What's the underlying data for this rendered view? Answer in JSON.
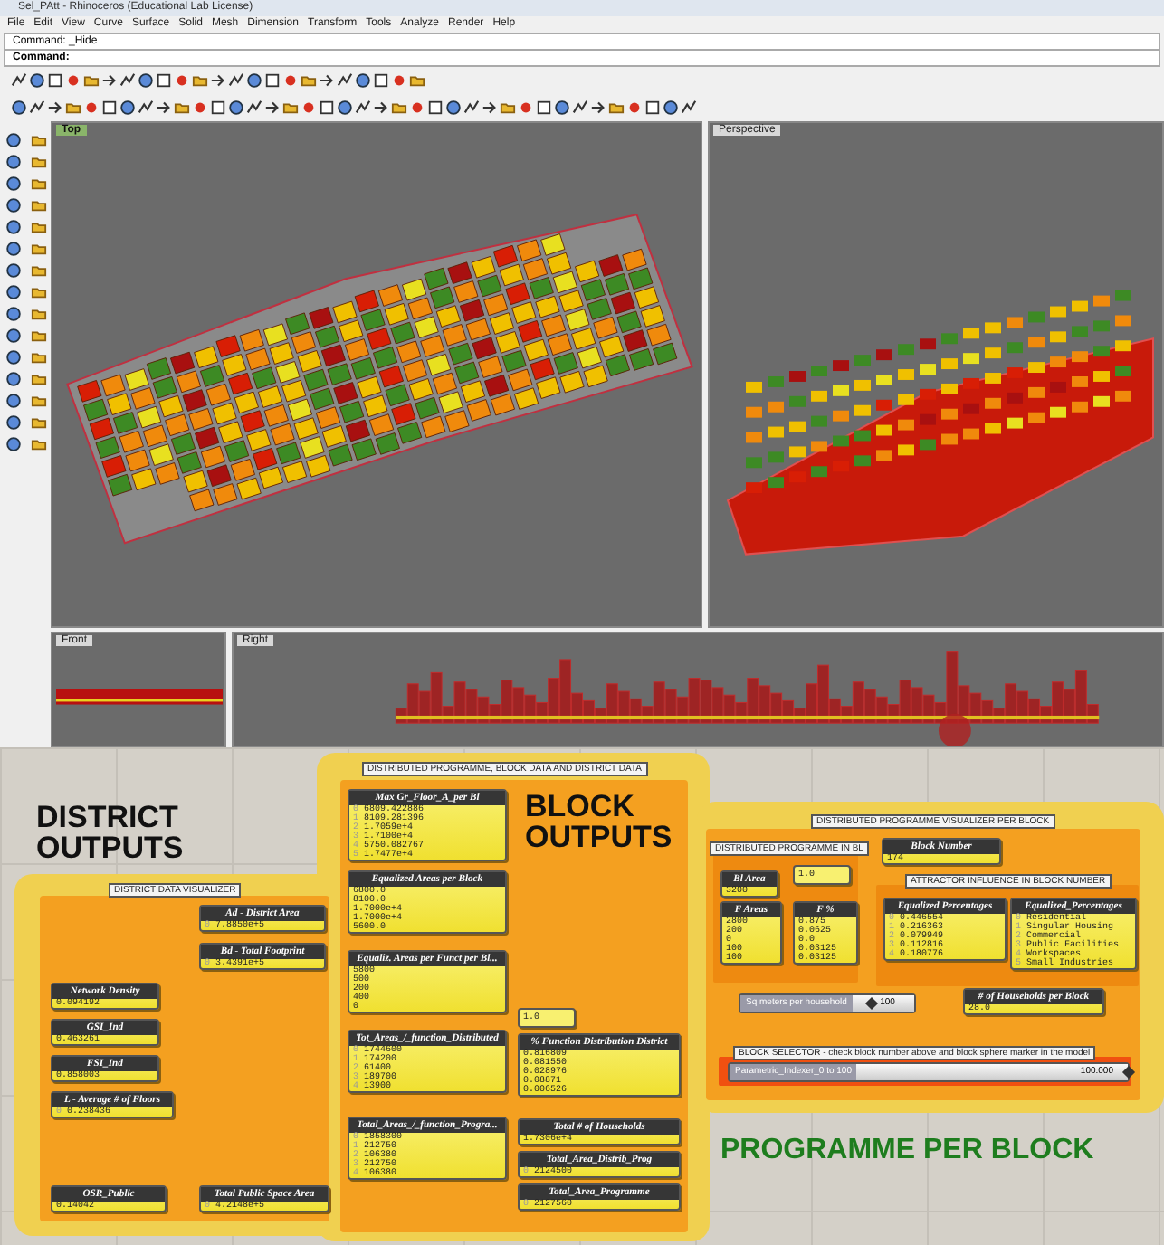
{
  "window": {
    "title": "Sel_PAtt - Rhinoceros (Educational Lab License)"
  },
  "menu": [
    "File",
    "Edit",
    "View",
    "Curve",
    "Surface",
    "Solid",
    "Mesh",
    "Dimension",
    "Transform",
    "Tools",
    "Analyze",
    "Render",
    "Help"
  ],
  "command_history": "Command: _Hide",
  "command_prompt": "Command:",
  "viewports": [
    {
      "label": "Top",
      "selected": true
    },
    {
      "label": "Perspective",
      "selected": false
    },
    {
      "label": "Front",
      "selected": false
    },
    {
      "label": "Right",
      "selected": false
    }
  ],
  "canvas": {
    "headings": [
      {
        "text": "DISTRICT OUTPUTS",
        "kind": "dark"
      },
      {
        "text": "BLOCK OUTPUTS",
        "kind": "dark"
      },
      {
        "text": "PROGRAMME PER BLOCK",
        "kind": "green"
      }
    ],
    "group_labels": [
      "DISTRICT DATA VISUALIZER",
      "DISTRIBUTED PROGRAMME, BLOCK DATA AND DISTRICT DATA",
      "DISTRIBUTED PROGRAMME VISUALIZER PER BLOCK",
      "DISTRIBUTED PROGRAMME IN BL",
      "ATTRACTOR INFLUENCE IN BLOCK NUMBER",
      "BLOCK SELECTOR - check block number above and block sphere marker in the model"
    ],
    "nodes": [
      {
        "kind": "panel",
        "title": "Ad - District Area",
        "rows": [
          {
            "index": "0",
            "value": "7.8850e+5"
          }
        ]
      },
      {
        "kind": "panel",
        "title": "Bd - Total Footprint",
        "rows": [
          {
            "index": "0",
            "value": "3.4391e+5"
          }
        ]
      },
      {
        "kind": "panel",
        "title": "Network Density",
        "rows": [
          {
            "value": "0.094192"
          }
        ]
      },
      {
        "kind": "panel",
        "title": "GSI_Ind",
        "rows": [
          {
            "value": "0.463261"
          }
        ]
      },
      {
        "kind": "panel",
        "title": "FSI_Ind",
        "rows": [
          {
            "value": "0.858003"
          }
        ]
      },
      {
        "kind": "panel",
        "title": "L - Average # of Floors",
        "rows": [
          {
            "index": "0",
            "value": "0.238436"
          }
        ]
      },
      {
        "kind": "panel",
        "title": "OSR_Public",
        "rows": [
          {
            "value": "0.14042"
          }
        ]
      },
      {
        "kind": "panel",
        "title": "Total Public Space Area",
        "rows": [
          {
            "index": "0",
            "value": "4.2148e+5"
          }
        ]
      },
      {
        "kind": "panel",
        "title": "Max Gr_Floor_A_per Bl",
        "rows": [
          {
            "index": "0",
            "value": "6809.422886"
          },
          {
            "index": "1",
            "value": "8109.281396"
          },
          {
            "index": "2",
            "value": "1.7059e+4"
          },
          {
            "index": "3",
            "value": "1.7100e+4"
          },
          {
            "index": "4",
            "value": "5750.082767"
          },
          {
            "index": "5",
            "value": "1.7477e+4"
          }
        ]
      },
      {
        "kind": "panel",
        "title": "Equalized Areas per Block",
        "rows": [
          {
            "value": "6800.0"
          },
          {
            "value": "8100.0"
          },
          {
            "value": "1.7000e+4"
          },
          {
            "value": "1.7000e+4"
          },
          {
            "value": "5600.0"
          }
        ]
      },
      {
        "kind": "panel",
        "title": "Equaliz. Areas per Funct per Bl...",
        "rows": [
          {
            "value": "5800"
          },
          {
            "value": "500"
          },
          {
            "value": "200"
          },
          {
            "value": "400"
          },
          {
            "value": "0"
          }
        ]
      },
      {
        "kind": "panel",
        "title": "Tot_Areas_/_function_Distributed",
        "rows": [
          {
            "index": "0",
            "value": "1744600"
          },
          {
            "index": "1",
            "value": "174200"
          },
          {
            "index": "2",
            "value": "61400"
          },
          {
            "index": "3",
            "value": "189700"
          },
          {
            "index": "4",
            "value": "13900"
          }
        ]
      },
      {
        "kind": "panel",
        "title": "Total_Areas_/_function_Progra...",
        "rows": [
          {
            "index": "0",
            "value": "1858300"
          },
          {
            "index": "1",
            "value": "212750"
          },
          {
            "index": "2",
            "value": "106380"
          },
          {
            "index": "3",
            "value": "212750"
          },
          {
            "index": "4",
            "value": "106380"
          }
        ]
      },
      {
        "kind": "value",
        "rows": [
          {
            "value": "1.0"
          }
        ]
      },
      {
        "kind": "panel",
        "title": "% Function Distribution District",
        "rows": [
          {
            "value": "0.816809"
          },
          {
            "value": "0.081550"
          },
          {
            "value": "0.028976"
          },
          {
            "value": "0.08871"
          },
          {
            "value": "0.006526"
          }
        ]
      },
      {
        "kind": "panel",
        "title": "Total # of Households",
        "rows": [
          {
            "value": "1.7306e+4"
          }
        ]
      },
      {
        "kind": "panel",
        "title": "Total_Area_Distrib_Prog",
        "rows": [
          {
            "index": "0",
            "value": "2124500"
          }
        ]
      },
      {
        "kind": "panel",
        "title": "Total_Area_Programme",
        "rows": [
          {
            "index": "0",
            "value": "2127560"
          }
        ]
      },
      {
        "kind": "panel",
        "title": "Bl Area",
        "rows": [
          {
            "value": "3200"
          }
        ]
      },
      {
        "kind": "value",
        "rows": [
          {
            "value": "1.0"
          }
        ]
      },
      {
        "kind": "panel",
        "title": "F Areas",
        "rows": [
          {
            "value": "2800"
          },
          {
            "value": "200"
          },
          {
            "value": "0"
          },
          {
            "value": "100"
          },
          {
            "value": "100"
          }
        ]
      },
      {
        "kind": "panel",
        "title": "F %",
        "rows": [
          {
            "value": "0.875"
          },
          {
            "value": "0.0625"
          },
          {
            "value": "0.0"
          },
          {
            "value": "0.03125"
          },
          {
            "value": "0.03125"
          }
        ]
      },
      {
        "kind": "panel",
        "title": "Block Number",
        "rows": [
          {
            "value": "174"
          }
        ]
      },
      {
        "kind": "panel",
        "title": "Equalized Percentages",
        "rows": [
          {
            "index": "0",
            "value": "0.446554"
          },
          {
            "index": "1",
            "value": "0.216363"
          },
          {
            "index": "2",
            "value": "0.079949"
          },
          {
            "index": "3",
            "value": "0.112816"
          },
          {
            "index": "4",
            "value": "0.180776"
          }
        ]
      },
      {
        "kind": "panel",
        "title": "Equalized_Percentages",
        "rows": [
          {
            "index": "0",
            "value": "Residential"
          },
          {
            "index": "1",
            "value": "Singular Housing"
          },
          {
            "index": "2",
            "value": "Commercial"
          },
          {
            "index": "3",
            "value": "Public Facilities"
          },
          {
            "index": "4",
            "value": "Workspaces"
          },
          {
            "index": "5",
            "value": "Small Industries"
          }
        ]
      },
      {
        "kind": "panel",
        "title": "# of Households per Block",
        "rows": [
          {
            "value": "28.0"
          }
        ]
      }
    ],
    "sliders": [
      {
        "label": "Sq meters per household",
        "value": "100",
        "level": 0.3
      },
      {
        "label": "Parametric_Indexer_0 to 100",
        "value": "100.000",
        "level": 1
      }
    ]
  }
}
